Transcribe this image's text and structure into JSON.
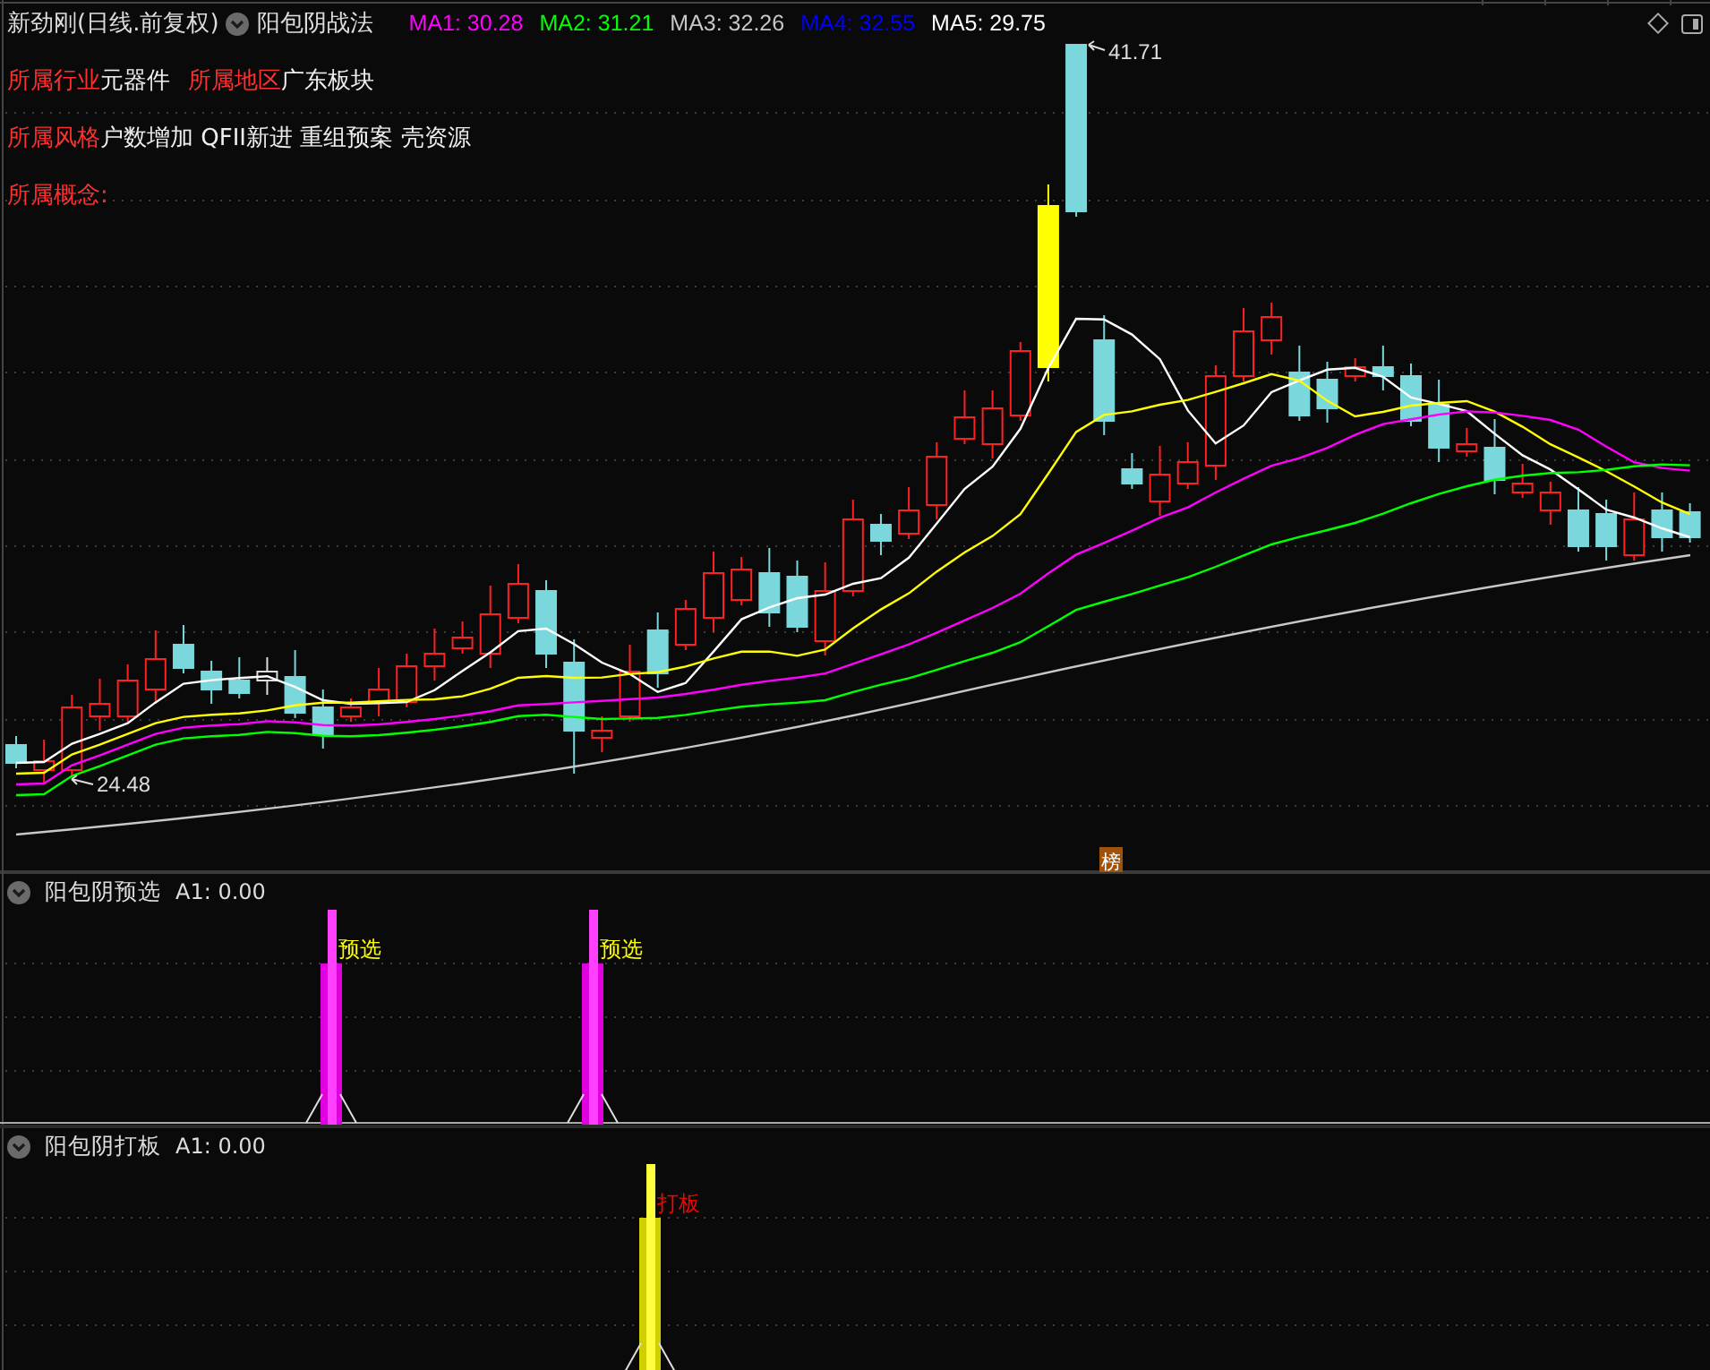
{
  "header": {
    "title": "新劲刚(日线.前复权)",
    "indicator": "阳包阴战法",
    "ma": [
      {
        "label": "MA1: 30.28",
        "color": "#ff00ff"
      },
      {
        "label": "MA2: 31.21",
        "color": "#00ff00"
      },
      {
        "label": "MA3: 32.26",
        "color": "#c8c8c8"
      },
      {
        "label": "MA4: 32.55",
        "color": "#0000ff"
      },
      {
        "label": "MA5: 29.75",
        "color": "#ffffff"
      }
    ]
  },
  "info_lines": [
    [
      {
        "label": "所属行业",
        "value": "元器件"
      },
      {
        "label": "所属地区",
        "value": "广东板块"
      }
    ],
    [
      {
        "label": "所属风格",
        "value": "户数增加 QFII新进 重组预案 壳资源"
      }
    ],
    [
      {
        "label": "所属概念:"
      }
    ]
  ],
  "price_chart": {
    "high_label": "41.71",
    "low_label": "24.48",
    "badge": "榜"
  },
  "panels": [
    {
      "kind": "select",
      "title": "阳包阴预选",
      "reading": "A1: 0.00",
      "signals": [
        "预选",
        "预选"
      ]
    },
    {
      "kind": "board",
      "title": "阳包阴打板",
      "reading": "A1: 0.00",
      "signals": [
        "打板"
      ]
    }
  ]
}
